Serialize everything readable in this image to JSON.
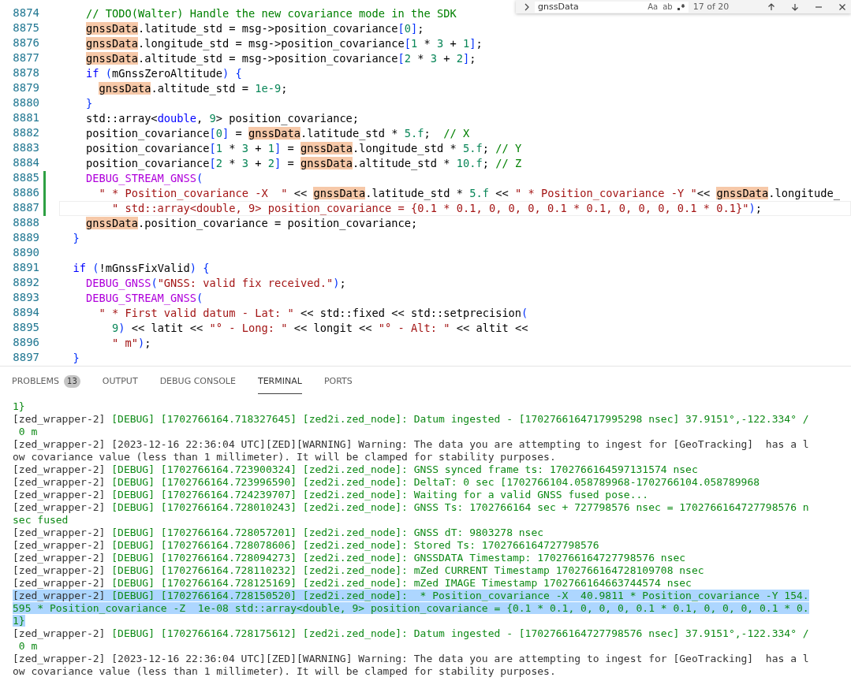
{
  "find_widget": {
    "query": "gnssData",
    "options": [
      "Aa",
      "ab"
    ],
    "count": "17 of 20"
  },
  "editor": {
    "lines": [
      {
        "number": "8874",
        "modified": false,
        "current": false,
        "tokens": [
          {
            "kind": "comment",
            "text": "    // TODO(Walter) Handle the new covariance mode in the SDK"
          }
        ]
      },
      {
        "number": "8875",
        "modified": false,
        "current": false,
        "tokens": [
          {
            "kind": "match",
            "text": "    gnssData"
          },
          {
            "kind": "plain",
            "text": ".latitude_std = msg->position_covariance"
          },
          {
            "kind": "bracket",
            "text": "["
          },
          {
            "kind": "number",
            "text": "0"
          },
          {
            "kind": "bracket",
            "text": "]"
          },
          {
            "kind": "plain",
            "text": ";"
          }
        ]
      },
      {
        "number": "8876",
        "modified": false,
        "current": false,
        "tokens": [
          {
            "kind": "match",
            "text": "    gnssData"
          },
          {
            "kind": "plain",
            "text": ".longitude_std = msg->position_covariance"
          },
          {
            "kind": "bracket",
            "text": "["
          },
          {
            "kind": "number",
            "text": "1"
          },
          {
            "kind": "plain",
            "text": " * "
          },
          {
            "kind": "number",
            "text": "3"
          },
          {
            "kind": "plain",
            "text": " + "
          },
          {
            "kind": "number",
            "text": "1"
          },
          {
            "kind": "bracket",
            "text": "]"
          },
          {
            "kind": "plain",
            "text": ";"
          }
        ]
      },
      {
        "number": "8877",
        "modified": false,
        "current": false,
        "tokens": [
          {
            "kind": "match",
            "text": "    gnssData"
          },
          {
            "kind": "plain",
            "text": ".altitude_std = msg->position_covariance"
          },
          {
            "kind": "bracket",
            "text": "["
          },
          {
            "kind": "number",
            "text": "2"
          },
          {
            "kind": "plain",
            "text": " * "
          },
          {
            "kind": "number",
            "text": "3"
          },
          {
            "kind": "plain",
            "text": " + "
          },
          {
            "kind": "number",
            "text": "2"
          },
          {
            "kind": "bracket",
            "text": "]"
          },
          {
            "kind": "plain",
            "text": ";"
          }
        ]
      },
      {
        "number": "8878",
        "modified": false,
        "current": false,
        "tokens": [
          {
            "kind": "keyword",
            "text": "    if"
          },
          {
            "kind": "bracket",
            "text": " ("
          },
          {
            "kind": "plain",
            "text": "mGnssZeroAltitude"
          },
          {
            "kind": "bracket",
            "text": ")"
          },
          {
            "kind": "bracket",
            "text": " {"
          }
        ]
      },
      {
        "number": "8879",
        "modified": false,
        "current": false,
        "tokens": [
          {
            "kind": "match",
            "text": "      gnssData"
          },
          {
            "kind": "plain",
            "text": ".altitude_std = "
          },
          {
            "kind": "number",
            "text": "1e-9"
          },
          {
            "kind": "plain",
            "text": ";"
          }
        ]
      },
      {
        "number": "8880",
        "modified": false,
        "current": false,
        "tokens": [
          {
            "kind": "bracket",
            "text": "    }"
          }
        ]
      },
      {
        "number": "8881",
        "modified": false,
        "current": false,
        "tokens": [
          {
            "kind": "plain",
            "text": "    std::array<"
          },
          {
            "kind": "keyword",
            "text": "double"
          },
          {
            "kind": "plain",
            "text": ", "
          },
          {
            "kind": "number",
            "text": "9"
          },
          {
            "kind": "plain",
            "text": "> position_covariance;"
          }
        ]
      },
      {
        "number": "8882",
        "modified": false,
        "current": false,
        "tokens": [
          {
            "kind": "plain",
            "text": "    position_covariance"
          },
          {
            "kind": "bracket",
            "text": "["
          },
          {
            "kind": "number",
            "text": "0"
          },
          {
            "kind": "bracket",
            "text": "]"
          },
          {
            "kind": "plain",
            "text": " = "
          },
          {
            "kind": "match",
            "text": "gnssData"
          },
          {
            "kind": "plain",
            "text": ".latitude_std * "
          },
          {
            "kind": "number",
            "text": "5.f"
          },
          {
            "kind": "plain",
            "text": ";"
          },
          {
            "kind": "comment",
            "text": "  // X"
          }
        ]
      },
      {
        "number": "8883",
        "modified": false,
        "current": false,
        "tokens": [
          {
            "kind": "plain",
            "text": "    position_covariance"
          },
          {
            "kind": "bracket",
            "text": "["
          },
          {
            "kind": "number",
            "text": "1"
          },
          {
            "kind": "plain",
            "text": " * "
          },
          {
            "kind": "number",
            "text": "3"
          },
          {
            "kind": "plain",
            "text": " + "
          },
          {
            "kind": "number",
            "text": "1"
          },
          {
            "kind": "bracket",
            "text": "]"
          },
          {
            "kind": "plain",
            "text": " = "
          },
          {
            "kind": "match",
            "text": "gnssData"
          },
          {
            "kind": "plain",
            "text": ".longitude_std * "
          },
          {
            "kind": "number",
            "text": "5.f"
          },
          {
            "kind": "plain",
            "text": ";"
          },
          {
            "kind": "comment",
            "text": " // Y"
          }
        ]
      },
      {
        "number": "8884",
        "modified": false,
        "current": false,
        "tokens": [
          {
            "kind": "plain",
            "text": "    position_covariance"
          },
          {
            "kind": "bracket",
            "text": "["
          },
          {
            "kind": "number",
            "text": "2"
          },
          {
            "kind": "plain",
            "text": " * "
          },
          {
            "kind": "number",
            "text": "3"
          },
          {
            "kind": "plain",
            "text": " + "
          },
          {
            "kind": "number",
            "text": "2"
          },
          {
            "kind": "bracket",
            "text": "]"
          },
          {
            "kind": "plain",
            "text": " = "
          },
          {
            "kind": "match",
            "text": "gnssData"
          },
          {
            "kind": "plain",
            "text": ".altitude_std * "
          },
          {
            "kind": "number",
            "text": "10.f"
          },
          {
            "kind": "plain",
            "text": ";"
          },
          {
            "kind": "comment",
            "text": " // Z"
          }
        ]
      },
      {
        "number": "8885",
        "modified": true,
        "current": false,
        "tokens": [
          {
            "kind": "macro",
            "text": "    DEBUG_STREAM_GNSS"
          },
          {
            "kind": "bracket",
            "text": "("
          }
        ]
      },
      {
        "number": "8886",
        "modified": true,
        "current": false,
        "tokens": [
          {
            "kind": "string",
            "text": "      \" * Position_covariance -X  \""
          },
          {
            "kind": "plain",
            "text": " << "
          },
          {
            "kind": "match",
            "text": "gnssData"
          },
          {
            "kind": "plain",
            "text": ".latitude_std * "
          },
          {
            "kind": "number",
            "text": "5.f"
          },
          {
            "kind": "plain",
            "text": " << "
          },
          {
            "kind": "string",
            "text": "\" * Position_covariance -Y \""
          },
          {
            "kind": "plain",
            "text": "<< "
          },
          {
            "kind": "match",
            "text": "gnssData"
          },
          {
            "kind": "plain",
            "text": ".longitude_"
          }
        ]
      },
      {
        "number": "8887",
        "modified": true,
        "current": true,
        "tokens": [
          {
            "kind": "string",
            "text": "        \" std::array<double, 9> position_covariance = {0.1 * 0.1, 0, 0, 0, 0.1 * 0.1, 0, 0, 0, 0.1 * 0.1}\""
          },
          {
            "kind": "bracket",
            "text": ")"
          },
          {
            "kind": "plain",
            "text": ";"
          }
        ]
      },
      {
        "number": "8888",
        "modified": false,
        "current": false,
        "tokens": [
          {
            "kind": "match",
            "text": "    gnssData"
          },
          {
            "kind": "plain",
            "text": ".position_covariance = position_covariance;"
          }
        ]
      },
      {
        "number": "8889",
        "modified": false,
        "current": false,
        "tokens": [
          {
            "kind": "bracket",
            "text": "  }"
          }
        ]
      },
      {
        "number": "8890",
        "modified": false,
        "current": false
      },
      {
        "number": "8891",
        "modified": false,
        "current": false,
        "tokens": [
          {
            "kind": "keyword",
            "text": "  if"
          },
          {
            "kind": "bracket",
            "text": " ("
          },
          {
            "kind": "plain",
            "text": "!mGnssFixValid"
          },
          {
            "kind": "bracket",
            "text": ")"
          },
          {
            "kind": "bracket",
            "text": " {"
          }
        ]
      },
      {
        "number": "8892",
        "modified": false,
        "current": false,
        "tokens": [
          {
            "kind": "macro",
            "text": "    DEBUG_GNSS"
          },
          {
            "kind": "bracket",
            "text": "("
          },
          {
            "kind": "string",
            "text": "\"GNSS: valid fix received.\""
          },
          {
            "kind": "bracket",
            "text": ")"
          },
          {
            "kind": "plain",
            "text": ";"
          }
        ]
      },
      {
        "number": "8893",
        "modified": false,
        "current": false,
        "tokens": [
          {
            "kind": "macro",
            "text": "    DEBUG_STREAM_GNSS"
          },
          {
            "kind": "bracket",
            "text": "("
          }
        ]
      },
      {
        "number": "8894",
        "modified": false,
        "current": false,
        "tokens": [
          {
            "kind": "string",
            "text": "      \" * First valid datum - Lat: \""
          },
          {
            "kind": "plain",
            "text": " << std::fixed << std::setprecision"
          },
          {
            "kind": "bracket",
            "text": "("
          }
        ]
      },
      {
        "number": "8895",
        "modified": false,
        "current": false,
        "tokens": [
          {
            "kind": "number",
            "text": "        9"
          },
          {
            "kind": "bracket",
            "text": ")"
          },
          {
            "kind": "plain",
            "text": " << latit << "
          },
          {
            "kind": "string",
            "text": "\"° - Long: \""
          },
          {
            "kind": "plain",
            "text": " << longit << "
          },
          {
            "kind": "string",
            "text": "\"° - Alt: \""
          },
          {
            "kind": "plain",
            "text": " << altit <<"
          }
        ]
      },
      {
        "number": "8896",
        "modified": false,
        "current": false,
        "tokens": [
          {
            "kind": "string",
            "text": "        \" m\""
          },
          {
            "kind": "bracket",
            "text": ")"
          },
          {
            "kind": "plain",
            "text": ";"
          }
        ]
      },
      {
        "number": "8897",
        "modified": false,
        "current": false,
        "tokens": [
          {
            "kind": "bracket",
            "text": "  }"
          }
        ]
      }
    ]
  },
  "panel": {
    "tabs": [
      {
        "label": "PROBLEMS",
        "badge": "13",
        "selected": false
      },
      {
        "label": "OUTPUT",
        "selected": false
      },
      {
        "label": "DEBUG CONSOLE",
        "selected": false
      },
      {
        "label": "TERMINAL",
        "selected": true
      },
      {
        "label": "PORTS",
        "selected": false
      }
    ],
    "terminal": [
      {
        "kind": "debug",
        "selected": false,
        "text": "1}"
      },
      {
        "kind": "debug",
        "selected": false,
        "prefix": "[zed_wrapper-2] ",
        "text": "[DEBUG] [1702766164.718327645] [zed2i.zed_node]: Datum ingested - [1702766164717995298 nsec] 37.9151°,-122.334° /"
      },
      {
        "kind": "debug",
        "selected": false,
        "text": " 0 m"
      },
      {
        "kind": "warning",
        "selected": false,
        "text": "[zed_wrapper-2] [2023-12-16 22:36:04 UTC][ZED][WARNING] Warning: The data you are attempting to ingest for [GeoTracking]  has a l"
      },
      {
        "kind": "warning",
        "selected": false,
        "text": "ow covariance value (less than 1 millimeter). It will be clamped for stability purposes."
      },
      {
        "kind": "debug",
        "selected": false,
        "prefix": "[zed_wrapper-2] ",
        "text": "[DEBUG] [1702766164.723900324] [zed2i.zed_node]: GNSS synced frame ts: 1702766164597131574 nsec"
      },
      {
        "kind": "debug",
        "selected": false,
        "prefix": "[zed_wrapper-2] ",
        "text": "[DEBUG] [1702766164.723996590] [zed2i.zed_node]: DeltaT: 0 sec [1702766104.058789968-1702766104.058789968"
      },
      {
        "kind": "debug",
        "selected": false,
        "prefix": "[zed_wrapper-2] ",
        "text": "[DEBUG] [1702766164.724239707] [zed2i.zed_node]: Waiting for a valid GNSS fused pose..."
      },
      {
        "kind": "debug",
        "selected": false,
        "prefix": "[zed_wrapper-2] ",
        "text": "[DEBUG] [1702766164.728010243] [zed2i.zed_node]: GNSS Ts: 1702766164 sec + 727798576 nsec = 1702766164727798576 n"
      },
      {
        "kind": "debug",
        "selected": false,
        "text": "sec fused"
      },
      {
        "kind": "debug",
        "selected": false,
        "prefix": "[zed_wrapper-2] ",
        "text": "[DEBUG] [1702766164.728057201] [zed2i.zed_node]: GNSS dT: 9803278 nsec"
      },
      {
        "kind": "debug",
        "selected": false,
        "prefix": "[zed_wrapper-2] ",
        "text": "[DEBUG] [1702766164.728078606] [zed2i.zed_node]: Stored Ts: 1702766164727798576"
      },
      {
        "kind": "debug",
        "selected": false,
        "prefix": "[zed_wrapper-2] ",
        "text": "[DEBUG] [1702766164.728094273] [zed2i.zed_node]: GNSSDATA Timestamp: 1702766164727798576 nsec"
      },
      {
        "kind": "debug",
        "selected": false,
        "prefix": "[zed_wrapper-2] ",
        "text": "[DEBUG] [1702766164.728110232] [zed2i.zed_node]: mZed CURRENT Timestamp 1702766164728109708 nsec"
      },
      {
        "kind": "debug",
        "selected": false,
        "prefix": "[zed_wrapper-2] ",
        "text": "[DEBUG] [1702766164.728125169] [zed2i.zed_node]: mZed IMAGE Timestamp 1702766164663744574 nsec"
      },
      {
        "kind": "debug",
        "selected": true,
        "prefix": "[zed_wrapper-2] ",
        "text": "[DEBUG] [1702766164.728150520] [zed2i.zed_node]:  * Position_covariance -X  40.9811 * Position_covariance -Y 154."
      },
      {
        "kind": "debug",
        "selected": true,
        "text": "595 * Position_covariance -Z  1e-08 std::array<double, 9> position_covariance = {0.1 * 0.1, 0, 0, 0, 0.1 * 0.1, 0, 0, 0, 0.1 * 0."
      },
      {
        "kind": "debug",
        "selected": true,
        "text": "1}"
      },
      {
        "kind": "debug",
        "selected": false,
        "prefix": "[zed_wrapper-2] ",
        "text": "[DEBUG] [1702766164.728175612] [zed2i.zed_node]: Datum ingested - [1702766164727798576 nsec] 37.9151°,-122.334° /"
      },
      {
        "kind": "debug",
        "selected": false,
        "text": " 0 m"
      },
      {
        "kind": "warning",
        "selected": false,
        "text": "[zed_wrapper-2] [2023-12-16 22:36:04 UTC][ZED][WARNING] Warning: The data you are attempting to ingest for [GeoTracking]  has a l"
      },
      {
        "kind": "warning",
        "selected": false,
        "text": "ow covariance value (less than 1 millimeter). It will be clamped for stability purposes."
      }
    ]
  }
}
